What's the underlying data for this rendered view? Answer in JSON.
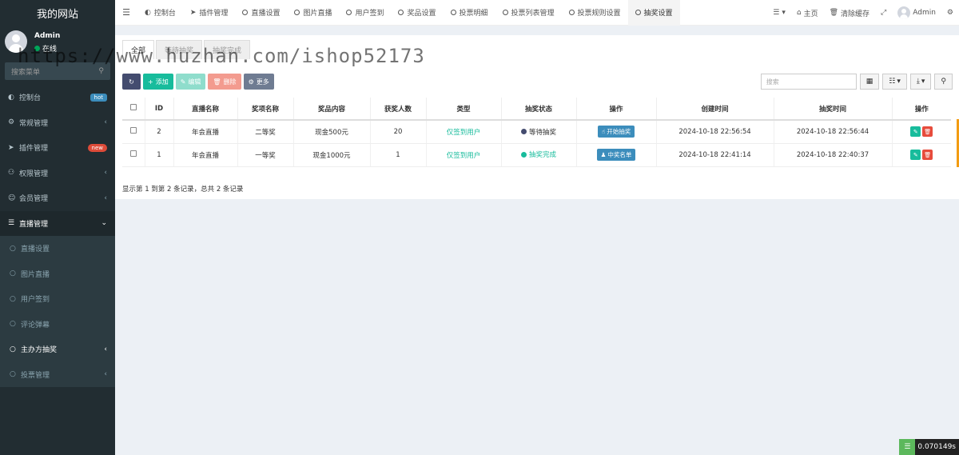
{
  "sidebar": {
    "brand": "我的网站",
    "user": {
      "name": "Admin",
      "status": "在线"
    },
    "search_placeholder": "搜索菜单",
    "items": [
      {
        "label": "控制台",
        "icon": "dashboard-icon",
        "badge": "hot"
      },
      {
        "label": "常规管理",
        "icon": "cogs-icon",
        "chevron": "‹"
      },
      {
        "label": "插件管理",
        "icon": "rocket-icon",
        "badge": "new"
      },
      {
        "label": "权限管理",
        "icon": "group-icon",
        "chevron": "‹"
      },
      {
        "label": "会员管理",
        "icon": "user-circle-icon",
        "chevron": "‹"
      },
      {
        "label": "直播管理",
        "icon": "list-icon",
        "chevron": "⌄"
      },
      {
        "label": "直播设置",
        "icon": "circle-icon"
      },
      {
        "label": "图片直播",
        "icon": "circle-icon"
      },
      {
        "label": "用户签到",
        "icon": "circle-icon"
      },
      {
        "label": "评论弹幕",
        "icon": "circle-icon"
      },
      {
        "label": "主办方抽奖",
        "icon": "circle-icon",
        "chevron": "‹"
      },
      {
        "label": "投票管理",
        "icon": "circle-icon",
        "chevron": "‹"
      }
    ]
  },
  "topnav": {
    "tabs": [
      {
        "label": "控制台",
        "icon": "dashboard-icon"
      },
      {
        "label": "插件管理",
        "icon": "rocket-icon"
      },
      {
        "label": "直播设置",
        "icon": "circle-icon"
      },
      {
        "label": "图片直播",
        "icon": "circle-icon"
      },
      {
        "label": "用户签到",
        "icon": "circle-icon"
      },
      {
        "label": "奖品设置",
        "icon": "circle-icon"
      },
      {
        "label": "投票明细",
        "icon": "circle-icon"
      },
      {
        "label": "投票列表管理",
        "icon": "circle-icon"
      },
      {
        "label": "投票规则设置",
        "icon": "circle-icon"
      },
      {
        "label": "抽奖设置",
        "icon": "circle-icon"
      }
    ],
    "right": {
      "home": "主页",
      "clear_cache": "清除缓存",
      "user": "Admin"
    }
  },
  "subtabs": [
    "全部",
    "等待抽奖",
    "抽奖完成"
  ],
  "toolbar": {
    "add": "添加",
    "edit": "编辑",
    "delete": "删除",
    "more": "更多",
    "search_placeholder": "搜索"
  },
  "table": {
    "headers": [
      "ID",
      "直播名称",
      "奖项名称",
      "奖品内容",
      "获奖人数",
      "类型",
      "抽奖状态",
      "操作",
      "创建时间",
      "抽奖时间",
      "操作"
    ],
    "rows": [
      {
        "id": "2",
        "live": "年会直播",
        "award": "二等奖",
        "prize": "现金500元",
        "count": "20",
        "type": "仅签到用户",
        "state": "等待抽奖",
        "action": "开始抽奖",
        "created": "2024-10-18 22:56:54",
        "drawn": "2024-10-18 22:56:44"
      },
      {
        "id": "1",
        "live": "年会直播",
        "award": "一等奖",
        "prize": "现金1000元",
        "count": "1",
        "type": "仅签到用户",
        "state": "抽奖完成",
        "action": "中奖名单",
        "created": "2024-10-18 22:41:14",
        "drawn": "2024-10-18 22:40:37"
      }
    ]
  },
  "pagination": "显示第 1 到第 2 条记录，总共 2 条记录",
  "watermark": "https://www.huzhan.com/ishop52173",
  "timer": "0.070149s"
}
